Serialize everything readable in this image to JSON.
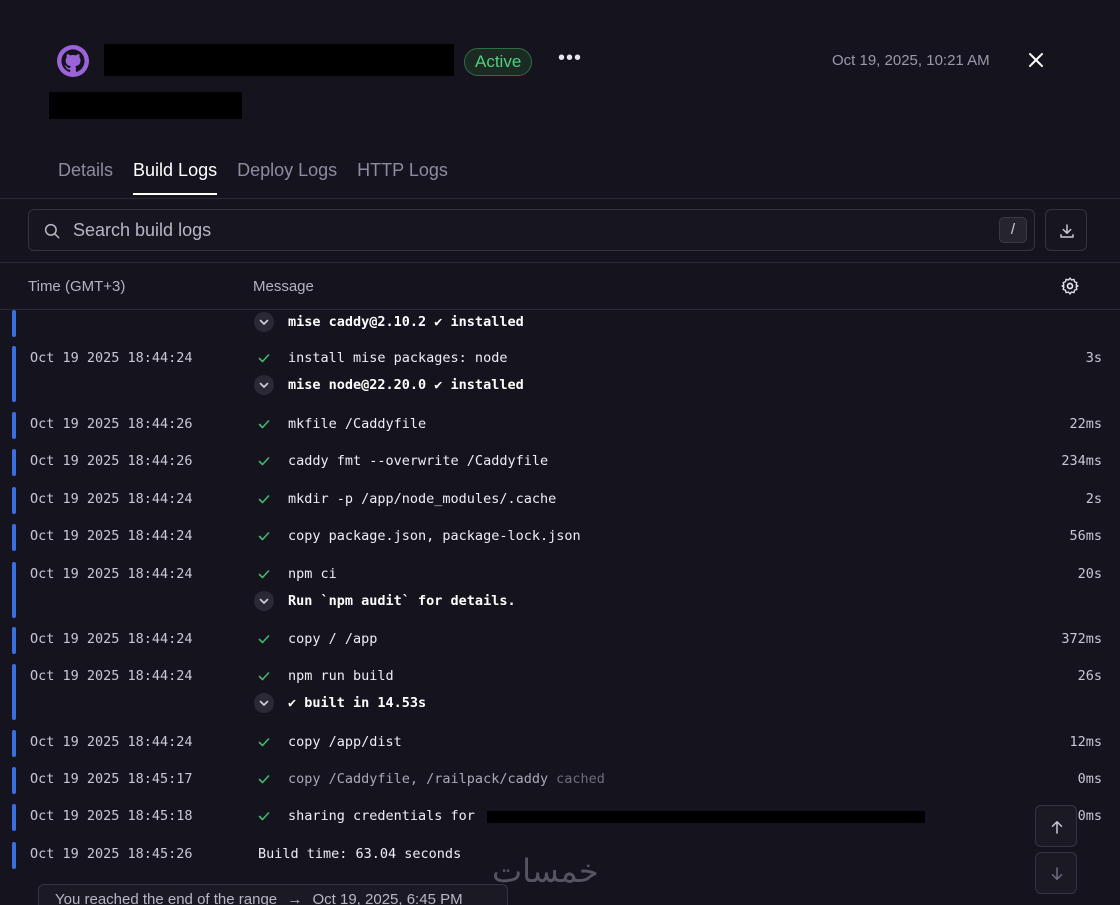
{
  "header": {
    "status_badge": "Active",
    "more_label": "•••",
    "timestamp": "Oct 19, 2025, 10:21 AM"
  },
  "tabs": [
    {
      "label": "Details",
      "active": false
    },
    {
      "label": "Build Logs",
      "active": true
    },
    {
      "label": "Deploy Logs",
      "active": false
    },
    {
      "label": "HTTP Logs",
      "active": false
    }
  ],
  "search": {
    "placeholder": "Search build logs",
    "shortcut": "/"
  },
  "columns": {
    "time": "Time (GMT+3)",
    "message": "Message"
  },
  "logs": [
    {
      "time": "",
      "lines": [
        {
          "icon": "chevron",
          "text": "mise caddy@2.10.2 ✔ installed",
          "bold": true,
          "duration": ""
        }
      ]
    },
    {
      "time": "Oct 19 2025 18:44:24",
      "lines": [
        {
          "icon": "check",
          "text": "install mise packages: node",
          "bold": false,
          "duration": "3s"
        },
        {
          "icon": "chevron",
          "text": "mise node@22.20.0 ✔ installed",
          "bold": true,
          "duration": ""
        }
      ]
    },
    {
      "time": "Oct 19 2025 18:44:26",
      "lines": [
        {
          "icon": "check",
          "text": "mkfile /Caddyfile",
          "bold": false,
          "duration": "22ms"
        }
      ]
    },
    {
      "time": "Oct 19 2025 18:44:26",
      "lines": [
        {
          "icon": "check",
          "text": "caddy fmt --overwrite /Caddyfile",
          "bold": false,
          "duration": "234ms"
        }
      ]
    },
    {
      "time": "Oct 19 2025 18:44:24",
      "lines": [
        {
          "icon": "check",
          "text": "mkdir -p /app/node_modules/.cache",
          "bold": false,
          "duration": "2s"
        }
      ]
    },
    {
      "time": "Oct 19 2025 18:44:24",
      "lines": [
        {
          "icon": "check",
          "text": "copy package.json, package-lock.json",
          "bold": false,
          "duration": "56ms"
        }
      ]
    },
    {
      "time": "Oct 19 2025 18:44:24",
      "lines": [
        {
          "icon": "check",
          "text": "npm ci",
          "bold": false,
          "duration": "20s"
        },
        {
          "icon": "chevron",
          "text": "Run `npm audit` for details.",
          "bold": true,
          "duration": ""
        }
      ]
    },
    {
      "time": "Oct 19 2025 18:44:24",
      "lines": [
        {
          "icon": "check",
          "text": "copy / /app",
          "bold": false,
          "duration": "372ms"
        }
      ]
    },
    {
      "time": "Oct 19 2025 18:44:24",
      "lines": [
        {
          "icon": "check",
          "text": "npm run build",
          "bold": false,
          "duration": "26s"
        },
        {
          "icon": "chevron",
          "text": "✔ built in 14.53s",
          "bold": true,
          "duration": ""
        }
      ]
    },
    {
      "time": "Oct 19 2025 18:44:24",
      "lines": [
        {
          "icon": "check",
          "text": "copy /app/dist",
          "bold": false,
          "duration": "12ms"
        }
      ]
    },
    {
      "time": "Oct 19 2025 18:45:17",
      "lines": [
        {
          "icon": "check",
          "text": "copy /Caddyfile, /railpack/caddy",
          "suffix": "cached",
          "dim": true,
          "bold": false,
          "duration": "0ms"
        }
      ]
    },
    {
      "time": "Oct 19 2025 18:45:18",
      "lines": [
        {
          "icon": "check",
          "text": "sharing credentials for ",
          "bold": false,
          "redacted": true,
          "duration": "0ms"
        }
      ]
    },
    {
      "time": "Oct 19 2025 18:45:26",
      "lines": [
        {
          "icon": "none",
          "text": "Build time: 63.04 seconds",
          "bold": false,
          "duration": ""
        }
      ]
    }
  ],
  "footer": {
    "range_text": "You reached the end of the range",
    "range_arrow": "→",
    "range_time": "Oct 19, 2025, 6:45 PM",
    "watermark": "خمسات"
  },
  "colors": {
    "background": "#15141e",
    "accent_bar": "#3b6fe0",
    "active_green": "#4fcf7f",
    "check_green": "#3fb86a"
  }
}
